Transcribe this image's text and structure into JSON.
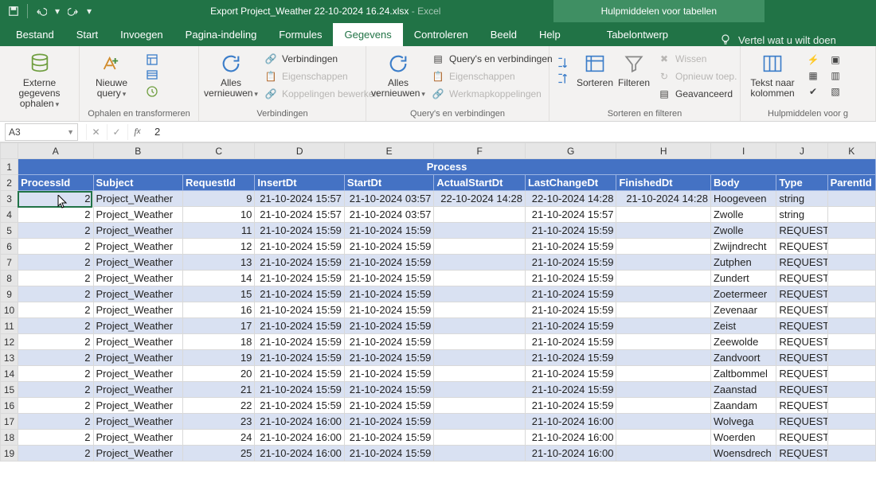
{
  "title": {
    "filename": "Export Project_Weather 22-10-2024 16.24.xlsx",
    "app": "Excel",
    "sep": "  -  "
  },
  "qat": {
    "save": "save",
    "undo": "undo",
    "redo": "redo"
  },
  "tooltab": {
    "title": "Hulpmiddelen voor tabellen",
    "tab": "Tabelontwerp"
  },
  "tabs": {
    "bestand": "Bestand",
    "start": "Start",
    "invoegen": "Invoegen",
    "pagina": "Pagina-indeling",
    "formules": "Formules",
    "gegevens": "Gegevens",
    "controleren": "Controleren",
    "beeld": "Beeld",
    "help": "Help",
    "tell": "Vertel wat u wilt doen"
  },
  "ribbon": {
    "g1": {
      "label": "",
      "btn": "Externe gegevens\nophalen"
    },
    "g2": {
      "label": "Ophalen en transformeren",
      "btn": "Nieuwe\nquery"
    },
    "g3": {
      "label": "Verbindingen",
      "btn": "Alles\nvernieuwen",
      "a": "Verbindingen",
      "b": "Eigenschappen",
      "c": "Koppelingen bewerken"
    },
    "g4": {
      "label": "Query's en verbindingen",
      "btn": "Alles\nvernieuwen",
      "a": "Query's en verbindingen",
      "b": "Eigenschappen",
      "c": "Werkmapkoppelingen"
    },
    "g5": {
      "label": "Sorteren en filteren",
      "sort": "Sorteren",
      "filter": "Filteren",
      "a": "Wissen",
      "b": "Opnieuw toep.",
      "c": "Geavanceerd"
    },
    "g6": {
      "label": "Hulpmiddelen voor g",
      "btn": "Tekst naar\nkolommen"
    }
  },
  "namebox": "A3",
  "formula": "2",
  "columns": [
    "A",
    "B",
    "C",
    "D",
    "E",
    "F",
    "G",
    "H",
    "I",
    "J",
    "K"
  ],
  "row1_title": "Process",
  "headers": [
    "ProcessId",
    "Subject",
    "RequestId",
    "InsertDt",
    "StartDt",
    "ActualStartDt",
    "LastChangeDt",
    "FinishedDt",
    "Body",
    "Type",
    "ParentId"
  ],
  "rows": [
    {
      "pid": 2,
      "subj": "Project_Weather",
      "req": 9,
      "ins": "21-10-2024 15:57",
      "st": "21-10-2024 03:57",
      "ast": "22-10-2024 14:28",
      "lc": "22-10-2024 14:28",
      "fin": "21-10-2024 14:28",
      "body": "Hoogeveen",
      "type": "string"
    },
    {
      "pid": 2,
      "subj": "Project_Weather",
      "req": 10,
      "ins": "21-10-2024 15:57",
      "st": "21-10-2024 03:57",
      "ast": "",
      "lc": "21-10-2024 15:57",
      "fin": "",
      "body": "Zwolle",
      "type": "string"
    },
    {
      "pid": 2,
      "subj": "Project_Weather",
      "req": 11,
      "ins": "21-10-2024 15:59",
      "st": "21-10-2024 15:59",
      "ast": "",
      "lc": "21-10-2024 15:59",
      "fin": "",
      "body": "Zwolle",
      "type": "REQUEST"
    },
    {
      "pid": 2,
      "subj": "Project_Weather",
      "req": 12,
      "ins": "21-10-2024 15:59",
      "st": "21-10-2024 15:59",
      "ast": "",
      "lc": "21-10-2024 15:59",
      "fin": "",
      "body": "Zwijndrecht",
      "type": "REQUEST"
    },
    {
      "pid": 2,
      "subj": "Project_Weather",
      "req": 13,
      "ins": "21-10-2024 15:59",
      "st": "21-10-2024 15:59",
      "ast": "",
      "lc": "21-10-2024 15:59",
      "fin": "",
      "body": "Zutphen",
      "type": "REQUEST"
    },
    {
      "pid": 2,
      "subj": "Project_Weather",
      "req": 14,
      "ins": "21-10-2024 15:59",
      "st": "21-10-2024 15:59",
      "ast": "",
      "lc": "21-10-2024 15:59",
      "fin": "",
      "body": "Zundert",
      "type": "REQUEST"
    },
    {
      "pid": 2,
      "subj": "Project_Weather",
      "req": 15,
      "ins": "21-10-2024 15:59",
      "st": "21-10-2024 15:59",
      "ast": "",
      "lc": "21-10-2024 15:59",
      "fin": "",
      "body": "Zoetermeer",
      "type": "REQUEST"
    },
    {
      "pid": 2,
      "subj": "Project_Weather",
      "req": 16,
      "ins": "21-10-2024 15:59",
      "st": "21-10-2024 15:59",
      "ast": "",
      "lc": "21-10-2024 15:59",
      "fin": "",
      "body": "Zevenaar",
      "type": "REQUEST"
    },
    {
      "pid": 2,
      "subj": "Project_Weather",
      "req": 17,
      "ins": "21-10-2024 15:59",
      "st": "21-10-2024 15:59",
      "ast": "",
      "lc": "21-10-2024 15:59",
      "fin": "",
      "body": "Zeist",
      "type": "REQUEST"
    },
    {
      "pid": 2,
      "subj": "Project_Weather",
      "req": 18,
      "ins": "21-10-2024 15:59",
      "st": "21-10-2024 15:59",
      "ast": "",
      "lc": "21-10-2024 15:59",
      "fin": "",
      "body": "Zeewolde",
      "type": "REQUEST"
    },
    {
      "pid": 2,
      "subj": "Project_Weather",
      "req": 19,
      "ins": "21-10-2024 15:59",
      "st": "21-10-2024 15:59",
      "ast": "",
      "lc": "21-10-2024 15:59",
      "fin": "",
      "body": "Zandvoort",
      "type": "REQUEST"
    },
    {
      "pid": 2,
      "subj": "Project_Weather",
      "req": 20,
      "ins": "21-10-2024 15:59",
      "st": "21-10-2024 15:59",
      "ast": "",
      "lc": "21-10-2024 15:59",
      "fin": "",
      "body": "Zaltbommel",
      "type": "REQUEST"
    },
    {
      "pid": 2,
      "subj": "Project_Weather",
      "req": 21,
      "ins": "21-10-2024 15:59",
      "st": "21-10-2024 15:59",
      "ast": "",
      "lc": "21-10-2024 15:59",
      "fin": "",
      "body": "Zaanstad",
      "type": "REQUEST"
    },
    {
      "pid": 2,
      "subj": "Project_Weather",
      "req": 22,
      "ins": "21-10-2024 15:59",
      "st": "21-10-2024 15:59",
      "ast": "",
      "lc": "21-10-2024 15:59",
      "fin": "",
      "body": "Zaandam",
      "type": "REQUEST"
    },
    {
      "pid": 2,
      "subj": "Project_Weather",
      "req": 23,
      "ins": "21-10-2024 16:00",
      "st": "21-10-2024 15:59",
      "ast": "",
      "lc": "21-10-2024 16:00",
      "fin": "",
      "body": "Wolvega",
      "type": "REQUEST"
    },
    {
      "pid": 2,
      "subj": "Project_Weather",
      "req": 24,
      "ins": "21-10-2024 16:00",
      "st": "21-10-2024 15:59",
      "ast": "",
      "lc": "21-10-2024 16:00",
      "fin": "",
      "body": "Woerden",
      "type": "REQUEST"
    },
    {
      "pid": 2,
      "subj": "Project_Weather",
      "req": 25,
      "ins": "21-10-2024 16:00",
      "st": "21-10-2024 15:59",
      "ast": "",
      "lc": "21-10-2024 16:00",
      "fin": "",
      "body": "Woensdrech",
      "type": "REQUEST"
    }
  ]
}
